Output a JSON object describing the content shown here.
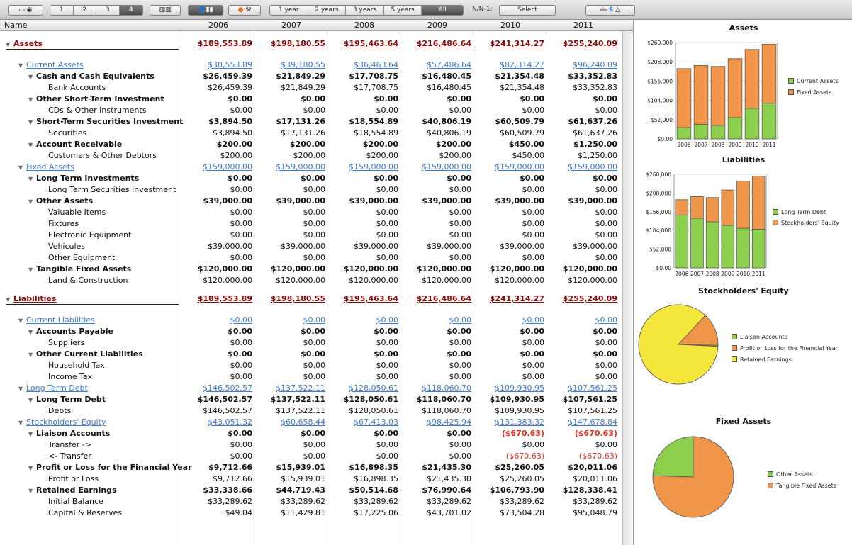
{
  "toolbar": {
    "levels": [
      "1",
      "2",
      "3",
      "4"
    ],
    "periods": [
      "1 year",
      "2 years",
      "3 years",
      "5 years",
      "All"
    ],
    "nn_label": "N/N-1:",
    "select_label": "Select",
    "currency_symbol": "$"
  },
  "columns": {
    "name": "Name",
    "years": [
      "2006",
      "2007",
      "2008",
      "2009",
      "2010",
      "2011"
    ]
  },
  "rows": [
    {
      "id": "assets",
      "label": "Assets",
      "level": 0,
      "open": true,
      "values": [
        "$189,553.89",
        "$198,180.55",
        "$195,463.64",
        "$216,486.64",
        "$241,314.27",
        "$255,240.09"
      ]
    },
    {
      "id": "current-assets",
      "label": "Current Assets",
      "level": 1,
      "open": true,
      "values": [
        "$30,553.89",
        "$39,180.55",
        "$36,463.64",
        "$57,486.64",
        "$82,314.27",
        "$96,240.09"
      ]
    },
    {
      "id": "cash",
      "label": "Cash and Cash Equivalents",
      "level": 2,
      "open": true,
      "values": [
        "$26,459.39",
        "$21,849.29",
        "$17,708.75",
        "$16,480.45",
        "$21,354.48",
        "$33,352.83"
      ]
    },
    {
      "id": "bank",
      "label": "Bank Accounts",
      "level": 3,
      "values": [
        "$26,459.39",
        "$21,849.29",
        "$17,708.75",
        "$16,480.45",
        "$21,354.48",
        "$33,352.83"
      ]
    },
    {
      "id": "oti",
      "label": "Other Short-Term Investment",
      "level": 2,
      "open": true,
      "values": [
        "$0.00",
        "$0.00",
        "$0.00",
        "$0.00",
        "$0.00",
        "$0.00"
      ]
    },
    {
      "id": "cds",
      "label": "CDs & Other Instruments",
      "level": 3,
      "values": [
        "$0.00",
        "$0.00",
        "$0.00",
        "$0.00",
        "$0.00",
        "$0.00"
      ]
    },
    {
      "id": "stsi",
      "label": "Short-Term Securities Investment",
      "level": 2,
      "open": true,
      "values": [
        "$3,894.50",
        "$17,131.26",
        "$18,554.89",
        "$40,806.19",
        "$60,509.79",
        "$61,637.26"
      ]
    },
    {
      "id": "securities",
      "label": "Securities",
      "level": 3,
      "values": [
        "$3,894.50",
        "$17,131.26",
        "$18,554.89",
        "$40,806.19",
        "$60,509.79",
        "$61,637.26"
      ]
    },
    {
      "id": "ar",
      "label": "Account Receivable",
      "level": 2,
      "open": true,
      "values": [
        "$200.00",
        "$200.00",
        "$200.00",
        "$200.00",
        "$450.00",
        "$1,250.00"
      ]
    },
    {
      "id": "customers",
      "label": "Customers & Other Debtors",
      "level": 3,
      "values": [
        "$200.00",
        "$200.00",
        "$200.00",
        "$200.00",
        "$450.00",
        "$1,250.00"
      ]
    },
    {
      "id": "fixed-assets",
      "label": "Fixed Assets",
      "level": 1,
      "open": true,
      "values": [
        "$159,000.00",
        "$159,000.00",
        "$159,000.00",
        "$159,000.00",
        "$159,000.00",
        "$159,000.00"
      ]
    },
    {
      "id": "lti",
      "label": "Long Term Investments",
      "level": 2,
      "open": true,
      "values": [
        "$0.00",
        "$0.00",
        "$0.00",
        "$0.00",
        "$0.00",
        "$0.00"
      ]
    },
    {
      "id": "ltsi",
      "label": "Long Term Securities Investment",
      "level": 3,
      "values": [
        "$0.00",
        "$0.00",
        "$0.00",
        "$0.00",
        "$0.00",
        "$0.00"
      ]
    },
    {
      "id": "other-assets",
      "label": "Other Assets",
      "level": 2,
      "open": true,
      "values": [
        "$39,000.00",
        "$39,000.00",
        "$39,000.00",
        "$39,000.00",
        "$39,000.00",
        "$39,000.00"
      ]
    },
    {
      "id": "valuable",
      "label": "Valuable Items",
      "level": 3,
      "values": [
        "$0.00",
        "$0.00",
        "$0.00",
        "$0.00",
        "$0.00",
        "$0.00"
      ]
    },
    {
      "id": "fixtures",
      "label": "Fixtures",
      "level": 3,
      "values": [
        "$0.00",
        "$0.00",
        "$0.00",
        "$0.00",
        "$0.00",
        "$0.00"
      ]
    },
    {
      "id": "electronic",
      "label": "Electronic Equipment",
      "level": 3,
      "values": [
        "$0.00",
        "$0.00",
        "$0.00",
        "$0.00",
        "$0.00",
        "$0.00"
      ]
    },
    {
      "id": "vehicules",
      "label": "Vehicules",
      "level": 3,
      "values": [
        "$39,000.00",
        "$39,000.00",
        "$39,000.00",
        "$39,000.00",
        "$39,000.00",
        "$39,000.00"
      ]
    },
    {
      "id": "other-equipment",
      "label": "Other Equipment",
      "level": 3,
      "values": [
        "$0.00",
        "$0.00",
        "$0.00",
        "$0.00",
        "$0.00",
        "$0.00"
      ]
    },
    {
      "id": "tfa",
      "label": "Tangible Fixed Assets",
      "level": 2,
      "open": true,
      "values": [
        "$120,000.00",
        "$120,000.00",
        "$120,000.00",
        "$120,000.00",
        "$120,000.00",
        "$120,000.00"
      ]
    },
    {
      "id": "land",
      "label": "Land & Construction",
      "level": 3,
      "values": [
        "$120,000.00",
        "$120,000.00",
        "$120,000.00",
        "$120,000.00",
        "$120,000.00",
        "$120,000.00"
      ]
    },
    {
      "id": "liabilities",
      "label": "Liabilities",
      "level": 0,
      "open": true,
      "values": [
        "$189,553.89",
        "$198,180.55",
        "$195,463.64",
        "$216,486.64",
        "$241,314.27",
        "$255,240.09"
      ]
    },
    {
      "id": "current-liabilities",
      "label": "Current Liabilities",
      "level": 1,
      "open": true,
      "values": [
        "$0.00",
        "$0.00",
        "$0.00",
        "$0.00",
        "$0.00",
        "$0.00"
      ]
    },
    {
      "id": "ap",
      "label": "Accounts Payable",
      "level": 2,
      "open": true,
      "values": [
        "$0.00",
        "$0.00",
        "$0.00",
        "$0.00",
        "$0.00",
        "$0.00"
      ]
    },
    {
      "id": "suppliers",
      "label": "Suppliers",
      "level": 3,
      "values": [
        "$0.00",
        "$0.00",
        "$0.00",
        "$0.00",
        "$0.00",
        "$0.00"
      ]
    },
    {
      "id": "ocl",
      "label": "Other Current Liabilities",
      "level": 2,
      "open": true,
      "values": [
        "$0.00",
        "$0.00",
        "$0.00",
        "$0.00",
        "$0.00",
        "$0.00"
      ]
    },
    {
      "id": "household",
      "label": "Household Tax",
      "level": 3,
      "values": [
        "$0.00",
        "$0.00",
        "$0.00",
        "$0.00",
        "$0.00",
        "$0.00"
      ]
    },
    {
      "id": "income-tax",
      "label": "Income Tax",
      "level": 3,
      "values": [
        "$0.00",
        "$0.00",
        "$0.00",
        "$0.00",
        "$0.00",
        "$0.00"
      ]
    },
    {
      "id": "ltd",
      "label": "Long Term Debt",
      "level": 1,
      "open": true,
      "values": [
        "$146,502.57",
        "$137,522.11",
        "$128,050.61",
        "$118,060.70",
        "$109,930.95",
        "$107,561.25"
      ]
    },
    {
      "id": "ltd2",
      "label": "Long Term Debt",
      "level": 2,
      "open": true,
      "values": [
        "$146,502.57",
        "$137,522.11",
        "$128,050.61",
        "$118,060.70",
        "$109,930.95",
        "$107,561.25"
      ]
    },
    {
      "id": "debts",
      "label": "Debts",
      "level": 3,
      "values": [
        "$146,502.57",
        "$137,522.11",
        "$128,050.61",
        "$118,060.70",
        "$109,930.95",
        "$107,561.25"
      ]
    },
    {
      "id": "equity",
      "label": "Stockholders' Equity",
      "level": 1,
      "open": true,
      "values": [
        "$43,051.32",
        "$60,658.44",
        "$67,413.03",
        "$98,425.94",
        "$131,383.32",
        "$147,678.84"
      ]
    },
    {
      "id": "liaison",
      "label": "Liaison Accounts",
      "level": 2,
      "open": true,
      "values": [
        "$0.00",
        "$0.00",
        "$0.00",
        "$0.00",
        "($670.63)",
        "($670.63)"
      ]
    },
    {
      "id": "transfer-out",
      "label": "Transfer ->",
      "level": 3,
      "values": [
        "$0.00",
        "$0.00",
        "$0.00",
        "$0.00",
        "$0.00",
        "$0.00"
      ]
    },
    {
      "id": "transfer-in",
      "label": "<- Transfer",
      "level": 3,
      "values": [
        "$0.00",
        "$0.00",
        "$0.00",
        "$0.00",
        "($670.63)",
        "($670.63)"
      ]
    },
    {
      "id": "pl",
      "label": "Profit or Loss for the Financial Year",
      "level": 2,
      "open": true,
      "values": [
        "$9,712.66",
        "$15,939.01",
        "$16,898.35",
        "$21,435.30",
        "$25,260.05",
        "$20,011.06"
      ]
    },
    {
      "id": "pl2",
      "label": "Profit or Loss",
      "level": 3,
      "values": [
        "$9,712.66",
        "$15,939.01",
        "$16,898.35",
        "$21,435.30",
        "$25,260.05",
        "$20,011.06"
      ]
    },
    {
      "id": "re",
      "label": "Retained Earnings",
      "level": 2,
      "open": true,
      "values": [
        "$33,338.66",
        "$44,719.43",
        "$50,514.68",
        "$76,990.64",
        "$106,793.90",
        "$128,338.41"
      ]
    },
    {
      "id": "ib",
      "label": "Initial Balance",
      "level": 3,
      "values": [
        "$33,289.62",
        "$33,289.62",
        "$33,289.62",
        "$33,289.62",
        "$33,289.62",
        "$33,289.62"
      ]
    },
    {
      "id": "capital",
      "label": "Capital & Reserves",
      "level": 3,
      "values": [
        "$49.04",
        "$11,429.81",
        "$17,225.06",
        "$43,701.02",
        "$73,504.28",
        "$95,048.79"
      ]
    }
  ],
  "colors": {
    "green": "#8ccf4d",
    "orange": "#f0964a",
    "yellow": "#f4e63c",
    "red_head": "#8b0a0a",
    "blue_head": "#3a7cd6",
    "negative": "#e0301e"
  },
  "chart_data": [
    {
      "type": "bar",
      "stacked": true,
      "title": "Assets",
      "categories": [
        "2006",
        "2007",
        "2008",
        "2009",
        "2010",
        "2011"
      ],
      "series": [
        {
          "name": "Current Assets",
          "color": "#8ccf4d",
          "values": [
            30553.89,
            39180.55,
            36463.64,
            57486.64,
            82314.27,
            96240.09
          ]
        },
        {
          "name": "Fixed Assets",
          "color": "#f0964a",
          "values": [
            159000,
            159000,
            159000,
            159000,
            159000,
            159000
          ]
        }
      ],
      "yticks": [
        "$0.00",
        "$52,000",
        "$104,000",
        "$156,000",
        "$208,000",
        "$260,000"
      ],
      "ylim": [
        0,
        260000
      ],
      "legend": "right"
    },
    {
      "type": "bar",
      "stacked": true,
      "title": "Liabilities",
      "categories": [
        "2006",
        "2007",
        "2008",
        "2009",
        "2010",
        "2011"
      ],
      "series": [
        {
          "name": "Long Term Debt",
          "color": "#8ccf4d",
          "values": [
            146502.57,
            137522.11,
            128050.61,
            118060.7,
            109930.95,
            107561.25
          ]
        },
        {
          "name": "Stockholders' Equity",
          "color": "#f0964a",
          "values": [
            43051.32,
            60658.44,
            67413.03,
            98425.94,
            131383.32,
            147678.84
          ]
        }
      ],
      "yticks": [
        "$0.00",
        "$52,000",
        "$104,000",
        "$156,000",
        "$208,000",
        "$260,000"
      ],
      "ylim": [
        0,
        260000
      ],
      "legend": "right"
    },
    {
      "type": "pie",
      "title": "Stockholders' Equity",
      "slices": [
        {
          "name": "Liaison Accounts",
          "color": "#8ccf4d",
          "value": 670.63
        },
        {
          "name": "Profit or Loss for the Financial Year",
          "color": "#f0964a",
          "value": 20011.06
        },
        {
          "name": "Retained Earnings",
          "color": "#f4e63c",
          "value": 128338.41
        }
      ],
      "legend": "right"
    },
    {
      "type": "pie",
      "title": "Fixed Assets",
      "slices": [
        {
          "name": "Other Assets",
          "color": "#8ccf4d",
          "value": 39000
        },
        {
          "name": "Tangible Fixed Assets",
          "color": "#f0964a",
          "value": 120000
        }
      ],
      "legend": "right"
    }
  ]
}
